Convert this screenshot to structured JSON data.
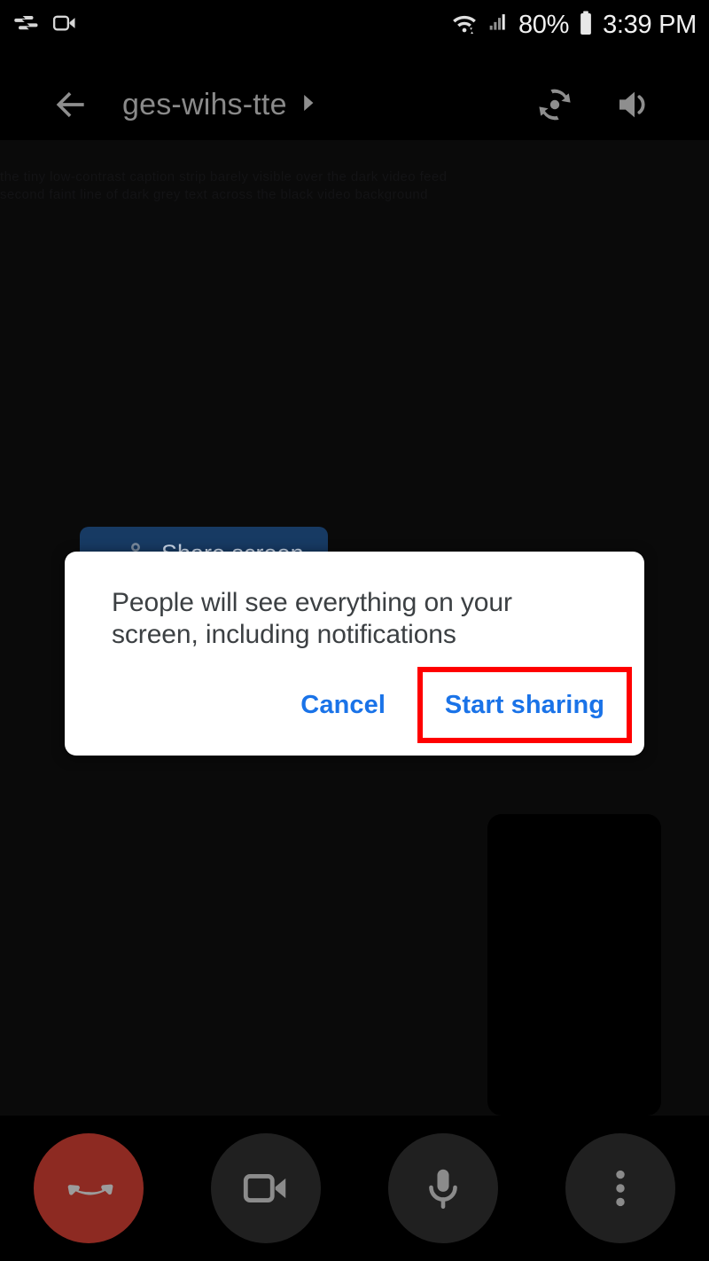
{
  "status_bar": {
    "left_icons": [
      {
        "name": "hangouts-icon",
        "label": "Hangouts"
      },
      {
        "name": "video-call-icon",
        "label": "Video call"
      }
    ],
    "right_icons": [
      {
        "name": "wifi-icon",
        "label": "Wi-Fi"
      },
      {
        "name": "cellular-signal-icon",
        "label": "Cellular signal"
      },
      {
        "name": "battery-icon",
        "label": "Battery"
      }
    ],
    "battery_percent": "80%",
    "clock": "3:39 PM"
  },
  "top_nav": {
    "back_label": "Back",
    "call_title": "ges-wihs-tte",
    "title_chevron": "▶",
    "switch_camera_label": "Switch camera",
    "speaker_label": "Speaker"
  },
  "video_stage": {
    "faint_lines": [
      "the tiny low-contrast caption strip barely visible over the dark video feed",
      "second faint line of dark grey text across the black video background"
    ]
  },
  "share_card": {
    "label": "Share screen",
    "icon": "screen-share-icon",
    "color": "#173a63"
  },
  "self_view": {
    "label": "Self view",
    "color": "#000000"
  },
  "dialog": {
    "message": "People will see everything on your screen, including notifications",
    "cancel_label": "Cancel",
    "start_sharing_label": "Start sharing",
    "accent_color": "#1a73e8",
    "highlight_color": "#ff0000",
    "background": "#ffffff"
  },
  "control_bar": {
    "buttons": [
      {
        "name": "end-call-button",
        "label": "End call",
        "icon": "phone-hangup-icon",
        "color": "#8d2a22"
      },
      {
        "name": "camera-toggle-button",
        "label": "Camera",
        "icon": "video-camera-icon",
        "color": "#202020"
      },
      {
        "name": "mic-toggle-button",
        "label": "Microphone",
        "icon": "microphone-icon",
        "color": "#202020"
      },
      {
        "name": "more-options-button",
        "label": "More options",
        "icon": "three-dots-vertical-icon",
        "color": "#202020"
      }
    ]
  }
}
